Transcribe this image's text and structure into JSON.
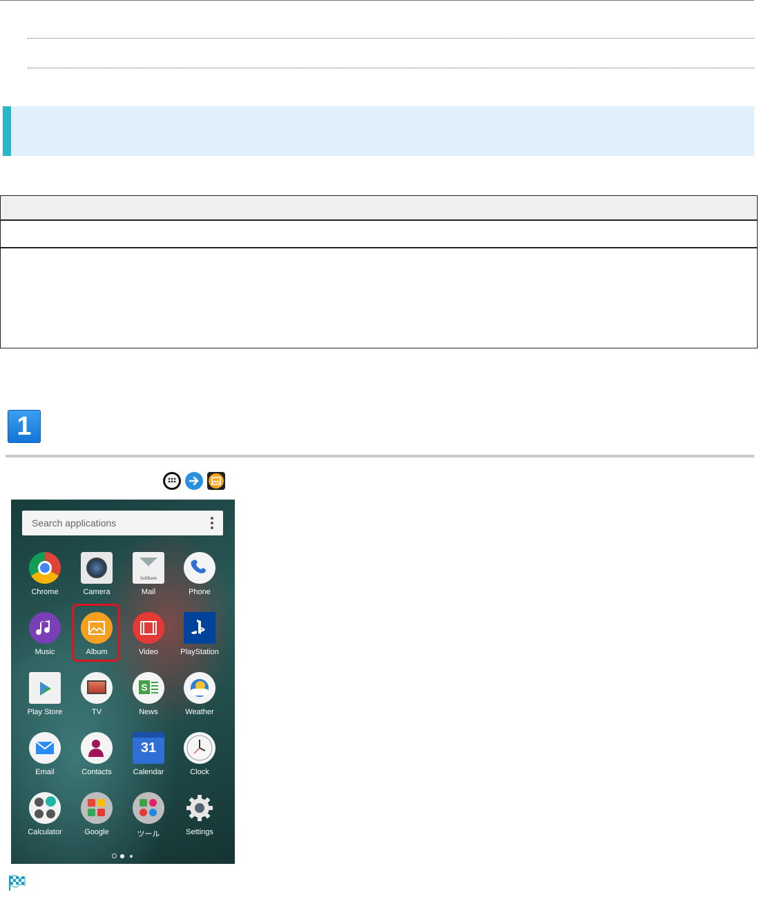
{
  "search": {
    "placeholder": "Search applications"
  },
  "apps": [
    {
      "label": "Chrome"
    },
    {
      "label": "Camera"
    },
    {
      "label": "Mail"
    },
    {
      "label": "Phone"
    },
    {
      "label": "Music"
    },
    {
      "label": "Album"
    },
    {
      "label": "Video"
    },
    {
      "label": "PlayStation"
    },
    {
      "label": "Play Store"
    },
    {
      "label": "TV"
    },
    {
      "label": "News"
    },
    {
      "label": "Weather"
    },
    {
      "label": "Email"
    },
    {
      "label": "Contacts"
    },
    {
      "label": "Calendar"
    },
    {
      "label": "Clock"
    },
    {
      "label": "Calculator"
    },
    {
      "label": "Google"
    },
    {
      "label": "ツール"
    },
    {
      "label": "Settings"
    }
  ],
  "step": {
    "number": "1"
  },
  "mail_icon": {
    "brand": "SoftBank"
  },
  "calendar_icon": {
    "day": "31"
  },
  "colors": {
    "info_bg": "#dff0fa",
    "info_bar": "#2ab5c8",
    "highlight": "#e0141c"
  }
}
